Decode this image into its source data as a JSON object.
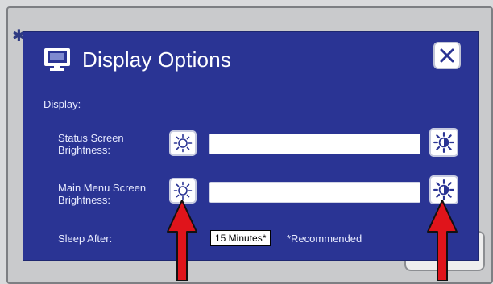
{
  "colors": {
    "dialog_bg": "#2a3494",
    "label_text": "#e8ebff",
    "arrow_red": "#e0141b"
  },
  "dialog": {
    "title": "Display Options",
    "title_icon": "monitor-icon",
    "close_icon": "close-icon",
    "section_label": "Display:"
  },
  "settings": {
    "status_brightness": {
      "label_line1": "Status Screen",
      "label_line2": "Brightness:",
      "decrease_icon": "sun-dim-icon",
      "increase_icon": "sun-bright-icon",
      "level": 1.0
    },
    "main_menu_brightness": {
      "label_line1": "Main Menu Screen",
      "label_line2": "Brightness:",
      "decrease_icon": "sun-dim-icon",
      "increase_icon": "sun-bright-icon",
      "level": 1.0
    },
    "sleep_after": {
      "label": "Sleep After:",
      "value": "15 Minutes*",
      "note": "*Recommended"
    }
  },
  "background": {
    "gear_icon": "gear-icon"
  }
}
